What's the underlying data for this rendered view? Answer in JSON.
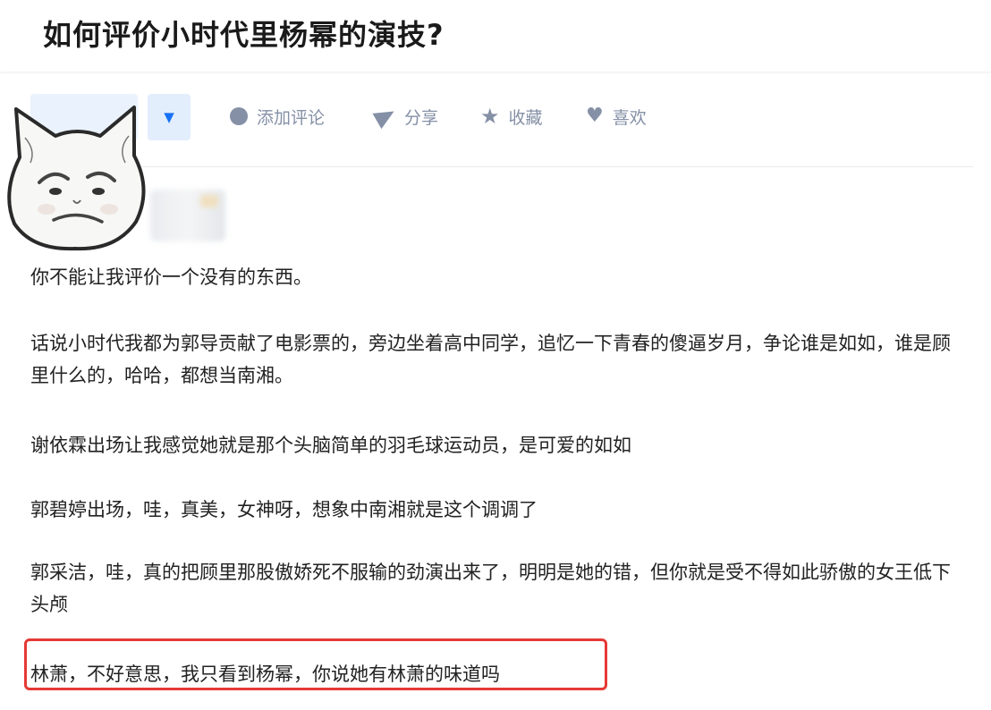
{
  "question": {
    "title": "如何评价小时代里杨幂的演技?"
  },
  "actions": {
    "vote_down_icon": "triangle-down-icon",
    "comment": {
      "label": "添加评论",
      "icon": "comment-bubble-icon"
    },
    "share": {
      "label": "分享",
      "icon": "paper-plane-icon"
    },
    "collect": {
      "label": "收藏",
      "icon": "star-icon"
    },
    "like": {
      "label": "喜欢",
      "icon": "heart-icon"
    }
  },
  "answer": {
    "paragraphs": [
      "你不能让我评价一个没有的东西。",
      "话说小时代我都为郭导贡献了电影票的，旁边坐着高中同学，追忆一下青春的傻逼岁月，争论谁是如如，谁是顾里什么的，哈哈，都想当南湘。",
      "谢依霖出场让我感觉她就是那个头脑简单的羽毛球运动员，是可爱的如如",
      "郭碧婷出场，哇，真美，女神呀，想象中南湘就是这个调调了",
      "郭采洁，哇，真的把顾里那股傲娇死不服输的劲演出来了，明明是她的错，但你就是受不得如此骄傲的女王低下头颅",
      "林萧，不好意思，我只看到杨幂，你说她有林萧的味道吗"
    ]
  },
  "colors": {
    "accent": "#1772f6",
    "icon_gray": "#8590a6",
    "highlight": "#e53935"
  }
}
